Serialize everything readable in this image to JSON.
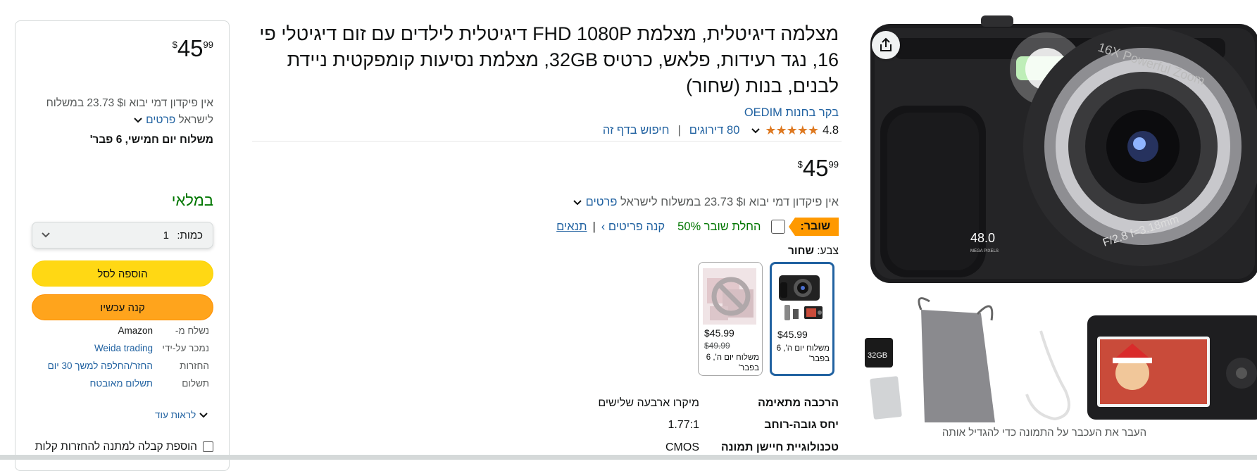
{
  "buy_box": {
    "price": {
      "symbol": "$",
      "whole": "45",
      "fraction": "99"
    },
    "shipping_text": "אין פיקדון דמי יבוא ו$ 23.73 במשלוח לישראל",
    "details_link": "פרטים",
    "delivery_prefix": "משלוח",
    "delivery_date": "יום חמישי, 6 פבר'",
    "stock": "במלאי",
    "quantity": {
      "label": "כמות:",
      "value": "1"
    },
    "add_to_cart": "הוספה לסל",
    "buy_now": "קנה עכשיו",
    "info": [
      {
        "key": "נשלח מ-",
        "value": "Amazon",
        "link": false
      },
      {
        "key": "נמכר על-ידי",
        "value": "Weida trading",
        "link": true
      },
      {
        "key": "החזרות",
        "value": "החזר/החלפה למשך 30 יום",
        "link": true
      },
      {
        "key": "תשלום",
        "value": "תשלום מאובטח",
        "link": true
      }
    ],
    "see_more": "לראות עוד",
    "gift_receipt": "הוספת קבלה למתנה להחזרות קלות"
  },
  "product": {
    "title": "מצלמה דיגיטלית, מצלמת FHD 1080P דיגיטלית לילדים עם זום דיגיטלי פי 16, נגד רעידות, פלאש, כרטיס 32GB, מצלמת נסיעות קומפקטית ניידת לבנים, בנות (שחור)",
    "brand_link": "בקר בחנות OEDIM",
    "rating_value": "4.8",
    "rating_stars": "★★★★★",
    "ratings_count": "80 דירוגים",
    "search_page": "חיפוש בדף זה",
    "price": {
      "symbol": "$",
      "whole": "45",
      "fraction": "99"
    },
    "shipping_text": "אין פיקדון דמי יבוא ו$ 23.73 במשלוח לישראל",
    "details_link": "פרטים",
    "coupon": {
      "badge": "שובר:",
      "apply_text": "החלת שובר 50%",
      "shop_items": "קנה פריטים ›",
      "pipe": "|",
      "terms": "תנאים"
    },
    "color": {
      "label": "צבע:",
      "value": "שחור"
    },
    "swatches": [
      {
        "price": "$45.99",
        "old_price": "",
        "ship": "משלוח יום ה', 6 בפבר'",
        "selected": true
      },
      {
        "price": "$45.99",
        "old_price": "$49.99",
        "ship": "משלוח יום ה', 6 בפבר'",
        "selected": false
      }
    ],
    "specs": [
      {
        "key": "הרכבה מתאימה",
        "value": "מיקרו ארבעה שלישים"
      },
      {
        "key": "יחס גובה-רוחב",
        "value": "1.77:1"
      },
      {
        "key": "טכנולוגיית חיישן תמונה",
        "value": "CMOS"
      }
    ]
  },
  "gallery": {
    "caption": "העבר את העכבר על התמונה כדי להגדיל אותה",
    "camera_lens_text": "16X Powerful Zoom",
    "camera_mp": "48.0",
    "camera_mp_sub": "MEGA PIXELS",
    "camera_aperture": "F/2.8  f=3.18mm",
    "sd_label": "32GB"
  }
}
